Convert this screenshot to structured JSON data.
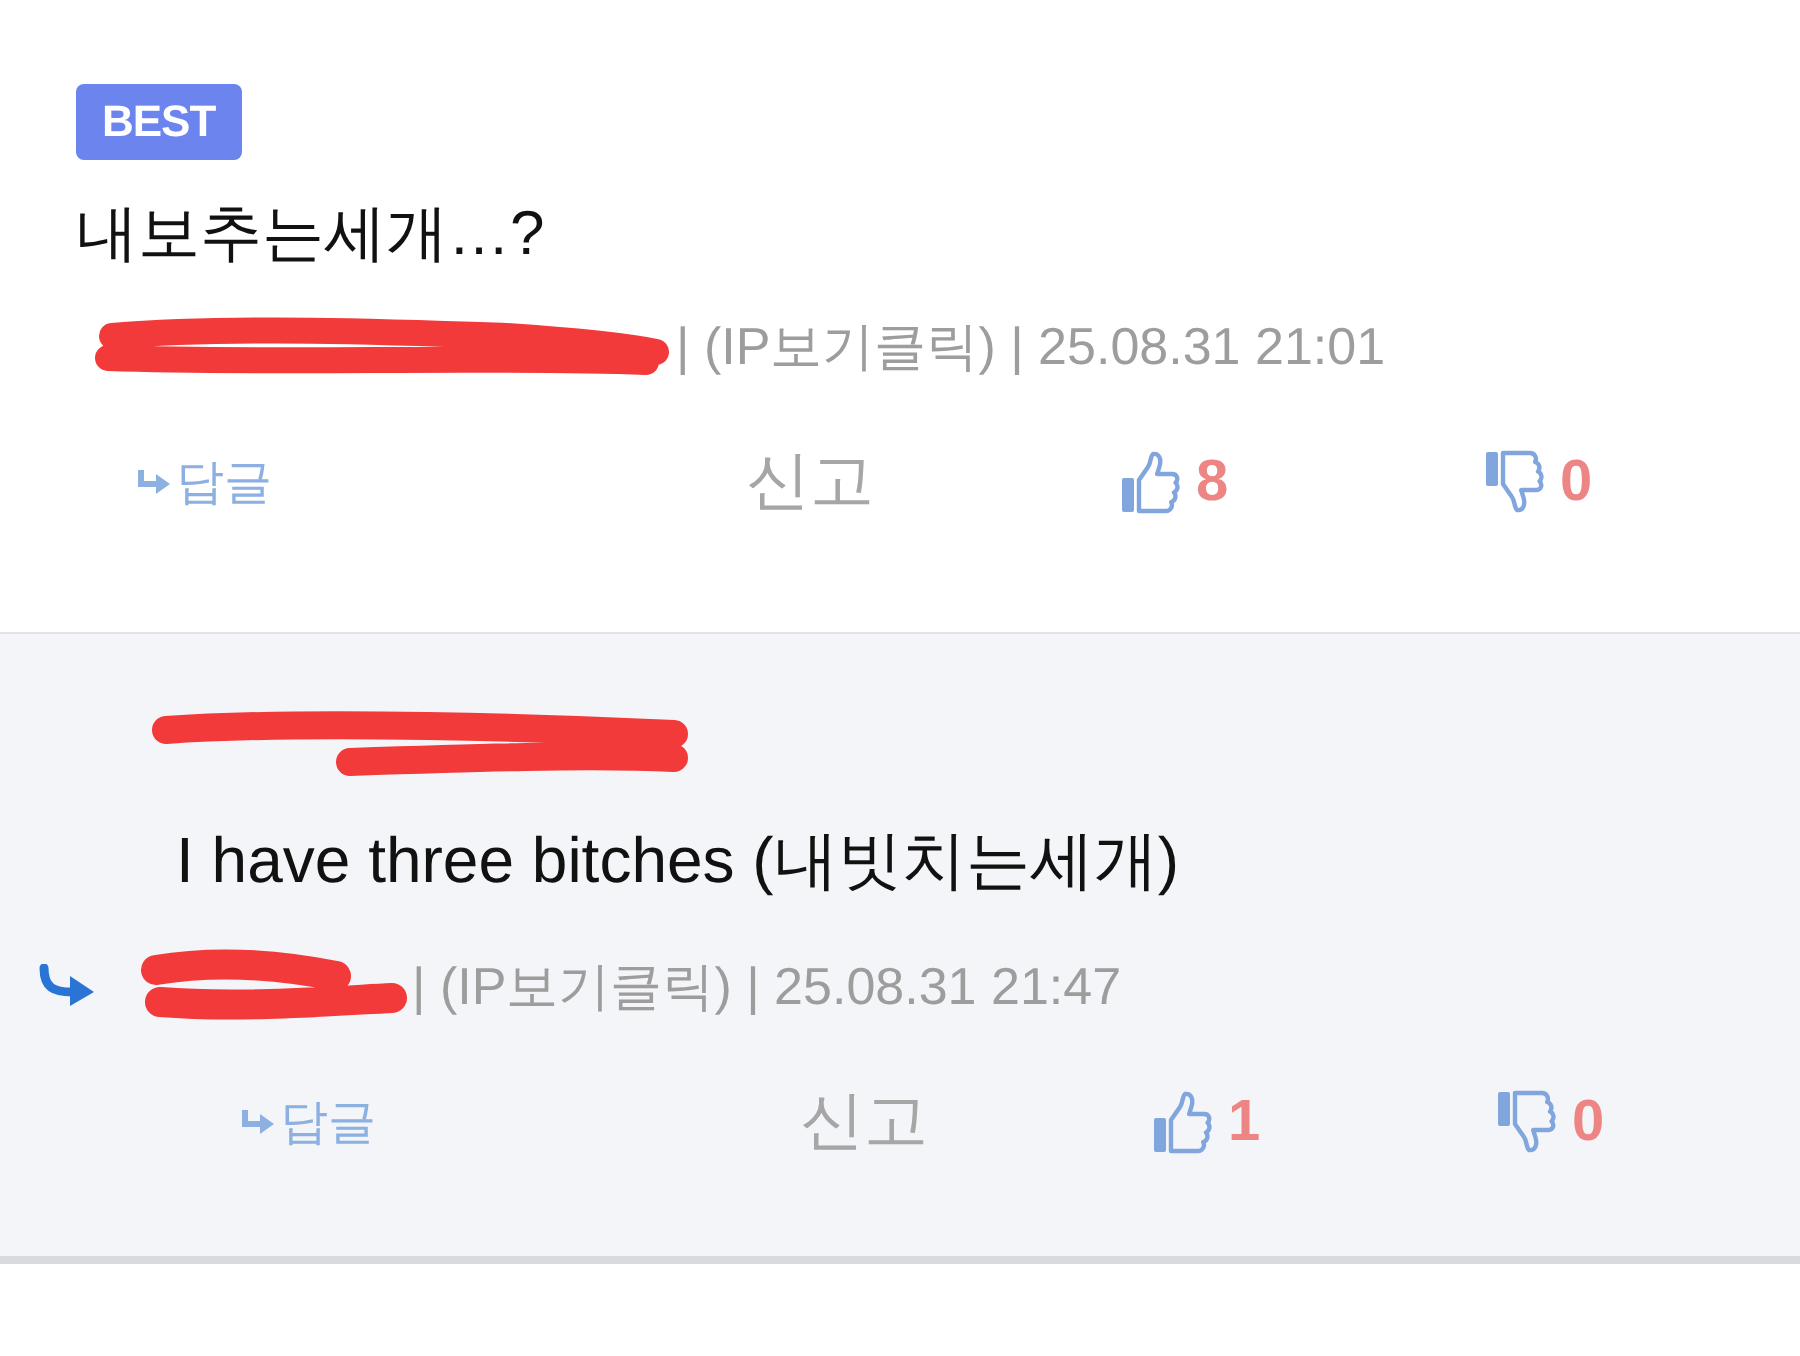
{
  "comments": [
    {
      "kind": "best",
      "badge": "BEST",
      "text": "내보추는세개…?",
      "meta": "| (IP보기클릭) | 25.08.31 21:01",
      "reply_label": "답글",
      "report_label": "신고",
      "likes": "8",
      "dislikes": "0"
    },
    {
      "kind": "reply",
      "text": "I have three bitches (내빗치는세개)",
      "meta": "| (IP보기클릭) | 25.08.31 21:47",
      "reply_label": "답글",
      "report_label": "신고",
      "likes": "1",
      "dislikes": "0"
    }
  ]
}
